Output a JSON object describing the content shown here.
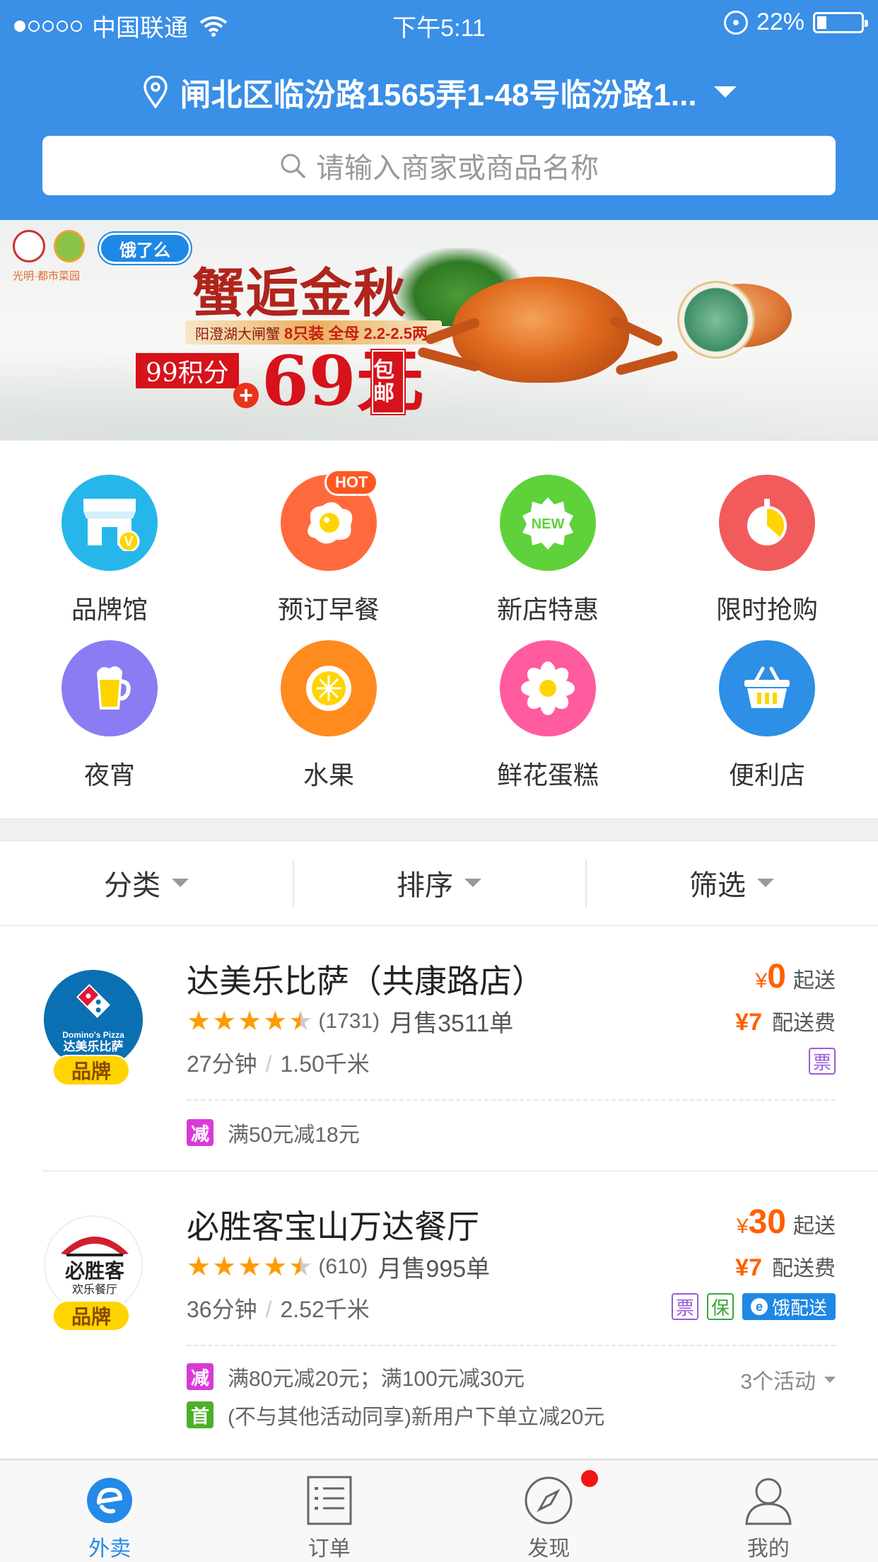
{
  "status_bar": {
    "carrier": "中国联通",
    "time": "下午5:11",
    "battery": "22%",
    "battery_level": 0.22
  },
  "header": {
    "address": "闸北区临汾路1565弄1-48号临汾路1...",
    "search_placeholder": "请输入商家或商品名称"
  },
  "banner": {
    "logo_text": "光明·都市菜园",
    "ele_logo": "饿了么",
    "title": "蟹逅金秋",
    "subtitle_prefix": "阳澄湖大闸蟹",
    "subtitle_bold": "8只装 全母 2.2-2.5两",
    "points": "99积分",
    "plus": "+",
    "price": "69元",
    "free_shipping": "包邮"
  },
  "categories": [
    {
      "label": "品牌馆",
      "color": "#27b6ea",
      "icon": "store-icon"
    },
    {
      "label": "预订早餐",
      "color": "#ff6a3d",
      "icon": "egg-icon",
      "badge": "HOT"
    },
    {
      "label": "新店特惠",
      "color": "#5fd13a",
      "icon": "new-icon",
      "badge_inner": "NEW"
    },
    {
      "label": "限时抢购",
      "color": "#f25b5b",
      "icon": "timer-icon"
    },
    {
      "label": "夜宵",
      "color": "#8a7cf2",
      "icon": "beer-icon"
    },
    {
      "label": "水果",
      "color": "#ff8a1e",
      "icon": "orange-icon"
    },
    {
      "label": "鲜花蛋糕",
      "color": "#ff5b9e",
      "icon": "flower-icon"
    },
    {
      "label": "便利店",
      "color": "#2d8fe6",
      "icon": "basket-icon"
    }
  ],
  "filters": [
    "分类",
    "排序",
    "筛选"
  ],
  "shops": [
    {
      "name": "达美乐比萨（共康路店）",
      "logo_text": "达美乐比萨",
      "logo_sub": "Domino's Pizza",
      "brand": "品牌",
      "rating": 4.5,
      "rating_count": "(1731)",
      "monthly": "月售3511单",
      "time": "27分钟",
      "distance": "1.50千米",
      "min_yen": "¥",
      "min_order": "0",
      "min_label": "起送",
      "fee": "¥7",
      "fee_label": "配送费",
      "badges": [
        "票"
      ],
      "promos": [
        {
          "tag": "减",
          "text": "满50元减18元"
        }
      ]
    },
    {
      "name": "必胜客宝山万达餐厅",
      "logo_text": "必胜客",
      "logo_sub": "欢乐餐厅",
      "brand": "品牌",
      "rating": 4.5,
      "rating_count": "(610)",
      "monthly": "月售995单",
      "time": "36分钟",
      "distance": "2.52千米",
      "min_yen": "¥",
      "min_order": "30",
      "min_label": "起送",
      "fee": "¥7",
      "fee_label": "配送费",
      "badges": [
        "票",
        "保",
        "饿配送"
      ],
      "more": "3个活动",
      "promos": [
        {
          "tag": "减",
          "text": "满80元减20元；满100元减30元"
        },
        {
          "tag": "首",
          "text": "(不与其他活动同享)新用户下单立减20元"
        }
      ]
    }
  ],
  "tabs": [
    {
      "label": "外卖",
      "icon": "ele-icon",
      "active": true
    },
    {
      "label": "订单",
      "icon": "order-list-icon"
    },
    {
      "label": "发现",
      "icon": "compass-icon",
      "dot": true
    },
    {
      "label": "我的",
      "icon": "user-icon"
    }
  ]
}
